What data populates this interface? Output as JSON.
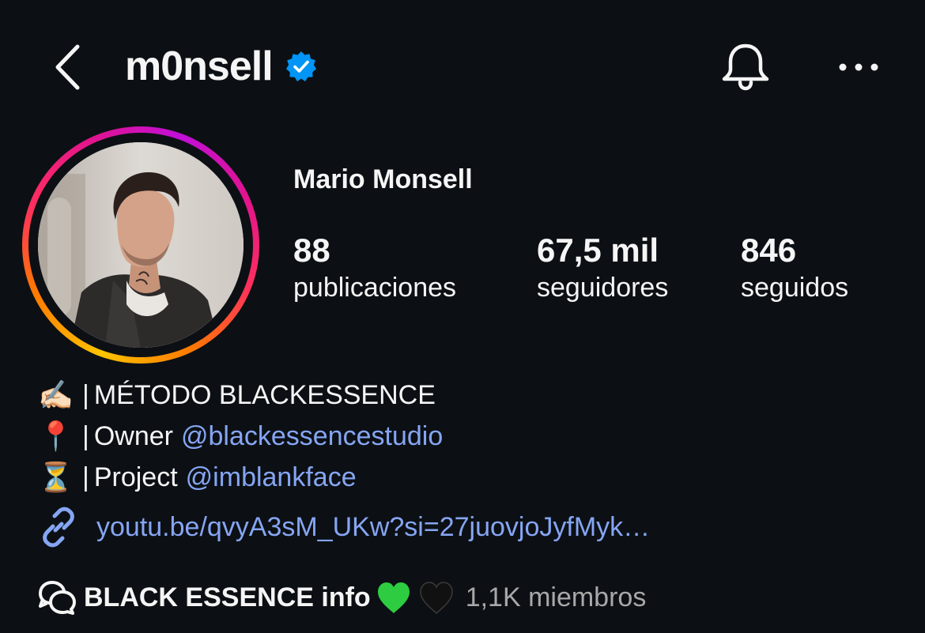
{
  "header": {
    "username": "m0nsell",
    "back_icon": "chevron-left-icon",
    "verified_icon": "verified-badge-icon",
    "bell_icon": "bell-icon",
    "more_icon": "more-horizontal-icon"
  },
  "profile": {
    "full_name": "Mario Monsell",
    "avatar": "profile-photo"
  },
  "stats": {
    "posts": {
      "value": "88",
      "label": "publicaciones"
    },
    "followers": {
      "value": "67,5 mil",
      "label": "seguidores"
    },
    "following": {
      "value": "846",
      "label": "seguidos"
    }
  },
  "bio": {
    "line1": {
      "emoji": "✍🏻",
      "separator": "|",
      "text": "MÉTODO BLACKESSENCE"
    },
    "line2": {
      "emoji": "📍",
      "separator": "|",
      "text": "Owner",
      "mention": "@blackessencestudio"
    },
    "line3": {
      "emoji": "⏳",
      "separator": "|",
      "text": "Project",
      "mention": "@imblankface"
    }
  },
  "link": {
    "icon": "link-icon",
    "text": "youtu.be/qvyA3sM_UKw?si=27juovjoJyfMyk…"
  },
  "channel": {
    "icon": "chat-bubbles-icon",
    "name": "BLACK ESSENCE info",
    "members": "1,1K miembros"
  },
  "colors": {
    "background": "#0c1014",
    "text": "#f5f5f5",
    "link": "#86a5f3",
    "muted": "#a8a8a8",
    "verified": "#0095f6",
    "green_heart": "#2ecc40"
  }
}
